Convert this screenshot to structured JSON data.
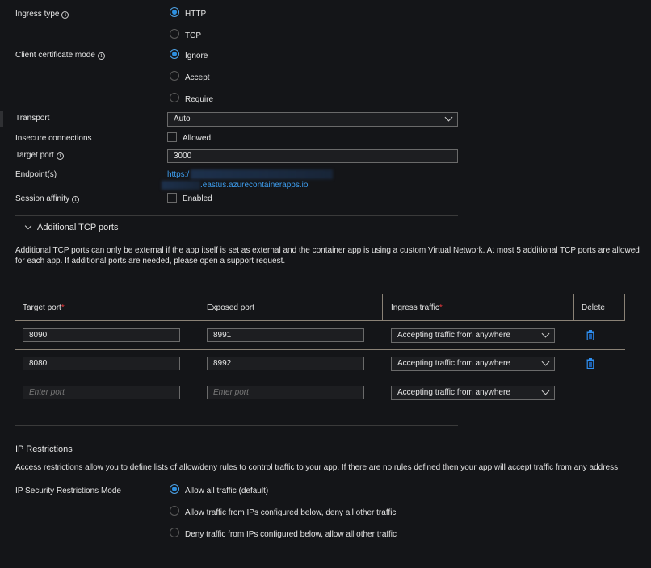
{
  "ingress_type": {
    "label": "Ingress type",
    "options": [
      {
        "label": "HTTP",
        "checked": true
      },
      {
        "label": "TCP",
        "checked": false
      }
    ]
  },
  "client_cert_mode": {
    "label": "Client certificate mode",
    "options": [
      {
        "label": "Ignore",
        "checked": true
      },
      {
        "label": "Accept",
        "checked": false
      },
      {
        "label": "Require",
        "checked": false
      }
    ]
  },
  "transport": {
    "label": "Transport",
    "value": "Auto"
  },
  "insecure_connections": {
    "label": "Insecure connections",
    "checkbox_label": "Allowed",
    "checked": false
  },
  "target_port": {
    "label": "Target port",
    "value": "3000"
  },
  "endpoints": {
    "label": "Endpoint(s)",
    "line1": "https:/",
    "line2": ".eastus.azurecontainerapps.io"
  },
  "session_affinity": {
    "label": "Session affinity",
    "checkbox_label": "Enabled",
    "checked": false
  },
  "additional_tcp": {
    "title": "Additional TCP ports",
    "description_line1": "Additional TCP ports can only be external if the app itself is set as external and the container app is using a custom Virtual Network. At most 5 additional TCP ports are allowed",
    "description_line2": "for each app. If additional ports are needed, please open a support request.",
    "columns": {
      "target_port": "Target port",
      "exposed_port": "Exposed port",
      "ingress_traffic": "Ingress traffic",
      "delete": "Delete"
    },
    "required_marker": "*",
    "rows": [
      {
        "target_port": "8090",
        "exposed_port": "8991",
        "ingress_traffic": "Accepting traffic from anywhere",
        "deletable": true
      },
      {
        "target_port": "8080",
        "exposed_port": "8992",
        "ingress_traffic": "Accepting traffic from anywhere",
        "deletable": true
      },
      {
        "target_port": "",
        "exposed_port": "",
        "ingress_traffic": "Accepting traffic from anywhere",
        "deletable": false
      }
    ],
    "placeholder": "Enter port"
  },
  "ip_restrictions": {
    "title": "IP Restrictions",
    "description": "Access restrictions allow you to define lists of allow/deny rules to control traffic to your app. If there are no rules defined then your app will accept traffic from any address.",
    "mode_label": "IP Security Restrictions Mode",
    "options": [
      {
        "label": "Allow all traffic (default)",
        "checked": true
      },
      {
        "label": "Allow traffic from IPs configured below, deny all other traffic",
        "checked": false
      },
      {
        "label": "Deny traffic from IPs configured below, allow all other traffic",
        "checked": false
      }
    ]
  },
  "icons": {
    "info": "i"
  },
  "colors": {
    "accent": "#2c8fe0",
    "link": "#3e9ef0",
    "required": "#e8383d",
    "background": "#141518"
  }
}
